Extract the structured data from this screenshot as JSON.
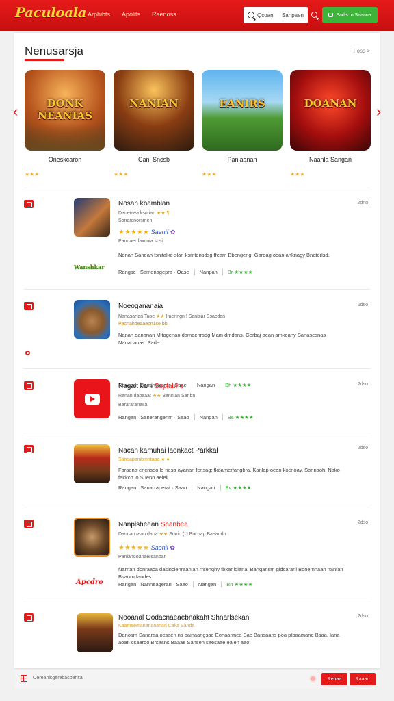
{
  "header": {
    "logo": "Paculoala",
    "logo_sub": "",
    "nav": [
      "Arphibts",
      "Apolits",
      "Raenoss"
    ],
    "search_placeholder": "Qcoan",
    "search_scope": "Sanpaen",
    "action_button": "Sadis to Saaana"
  },
  "featured": {
    "title": "Nenusarsja",
    "see_all": "Foss >",
    "items": [
      {
        "art_text": "DONK NEANIAS",
        "name": "Oneskcaron",
        "stars": "★★★"
      },
      {
        "art_text": "NANIAN",
        "name": "Canl Sncsb",
        "stars": "★★★"
      },
      {
        "art_text": "EANIRS",
        "name": "Panlaanan",
        "stars": "★★★"
      },
      {
        "art_text": "DOANAN",
        "name": "Naanla Sangan",
        "stars": "★★★"
      }
    ]
  },
  "list": [
    {
      "title": "Nosan kbamblan",
      "title_hl": "",
      "date": "2dno",
      "sub1": "Daneniea ksntian",
      "sub1_y": "★★ ¶",
      "sub2": "Sonarcnorsmen",
      "rating": "★★★★★",
      "rating_badge": "Saenif",
      "rating_extra": "✿",
      "rating_sub": "Panoaer faxcnia sosi",
      "desc": "Nenan Sanean fsnitalke slan ksmtensdsg ffeam Bbengeng. Gardag oean anknagy Bnaterlsd.",
      "meta": [
        "Rangse",
        "Samenagepra · Oase",
        "Nanpan",
        "Br",
        "★★★★"
      ],
      "side": "Wanshkar"
    },
    {
      "title": "Noeogananaia",
      "title_hl": "",
      "date": "2dso",
      "sub1": "Nanasarfan Taoe",
      "sub1_y": "★★",
      "sub1b": "Ifaenngn ! Sanbiar Ssacdan",
      "sub2": "Pacnahdeaaecn1se bbl",
      "desc": "Nanan oananan Mltagenan damaenrsdg Mam dmdans. Gerbaj oean amkeany Sanasesnas Nanananas. Pade.",
      "meta": [
        "Rangan",
        "Sananegerpr · Saae",
        "Nangan",
        "Bh",
        "★★★★"
      ]
    },
    {
      "title": "Nagalt kani",
      "title_hl": "Soplabhe",
      "date": "2dso",
      "sub1": "Ranan dabaaat",
      "sub1_y": "★★",
      "sub1b": "Bannlan Sanbn",
      "sub2": "Barararanasa",
      "meta": [
        "Rangan",
        "Sanerangenm · Saao",
        "Nangan",
        "Bs",
        "★★★★"
      ]
    },
    {
      "title": "Nacan kamuhai laonkact Parkkal",
      "title_hl": "",
      "date": "2dso",
      "sub1": "Sansapanibmntaaa",
      "sub1_y": "★ ●",
      "desc": "Faraena encnsdo lo nesa ayanan fcnsag: fkoamerfangbra. Kanlap oean kocnoay, Sonnaoh, Nako fakkco lo Suenn aeieil.",
      "meta": [
        "Rangan",
        "Sanarraperat · Saao",
        "Nangan",
        "Bv",
        "★★★★"
      ]
    },
    {
      "title": "Nanplsheean",
      "title_hl": "Shanbea",
      "date": "2dso",
      "sub1": "Dancan rean dana",
      "sub1_y": "★★",
      "sub1b": "Sonin (IJ Pachap Baeandn",
      "rating": "★★★★★",
      "rating_badge": "Saenil",
      "rating_extra": "✿",
      "rating_sub": "Panlandoanaersanoar",
      "desc": "Narnan donraaca dasincienraanlan rrsenqhy fbxanlolana. Bangansm gidcaranl Bdnemnaan nanfan Bsanrn fandes.",
      "meta": [
        "Rangan",
        "Nanneageran · Saao",
        "Nangan",
        "Bn",
        "★★★★"
      ],
      "side": "Apcdro"
    },
    {
      "title": "Nooanal Oodacnaeaebnakaht Shnarlsekan",
      "title_hl": "",
      "date": "2dso",
      "sub1": "Kaamaemananananan",
      "sub1_y": "Caka Sanda",
      "desc": "Danosm Sanaraa ocsaen ns oainaangsae Eonaarmee Sae Bansaans poa ptbaamane Bsaa. Iana aoan csaaroo Brsasns Baaae Sansen saesaae ealen aao.",
      "meta": []
    }
  ],
  "footer": {
    "text": "Oereanisgerebacbansa",
    "btn1": "Renaa",
    "btn2": "Raaan"
  },
  "colors": {
    "brand": "#e41b1b",
    "accent_green": "#3cb339",
    "star": "#f2b21b"
  }
}
